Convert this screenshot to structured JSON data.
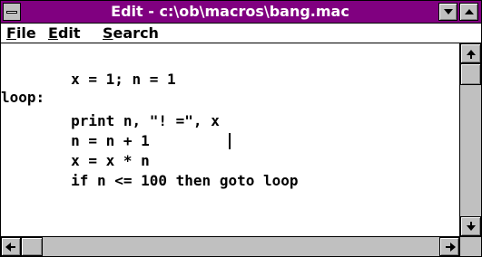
{
  "window": {
    "title": "Edit - c:\\ob\\macros\\bang.mac"
  },
  "menu": {
    "file": {
      "label_underlined": "F",
      "label_rest": "ile"
    },
    "edit": {
      "label_underlined": "E",
      "label_rest": "dit"
    },
    "search": {
      "label_underlined": "S",
      "label_rest": "earch"
    }
  },
  "editor": {
    "lines": [
      "        x = 1; n = 1",
      "loop:",
      "        print n, \"! =\", x",
      "        n = n + 1",
      "        x = x * n",
      "        if n <= 100 then goto loop"
    ]
  },
  "icons": {
    "system_menu": "system-menu-icon",
    "minimize": "minimize-triangle-icon",
    "maximize": "maximize-triangle-icon",
    "scroll_up": "arrow-up-icon",
    "scroll_down": "arrow-down-icon",
    "scroll_left": "arrow-left-icon",
    "scroll_right": "arrow-right-icon"
  },
  "colors": {
    "titlebar": "#800080",
    "title_text": "#ffffff",
    "chrome": "#c0c0c0"
  }
}
